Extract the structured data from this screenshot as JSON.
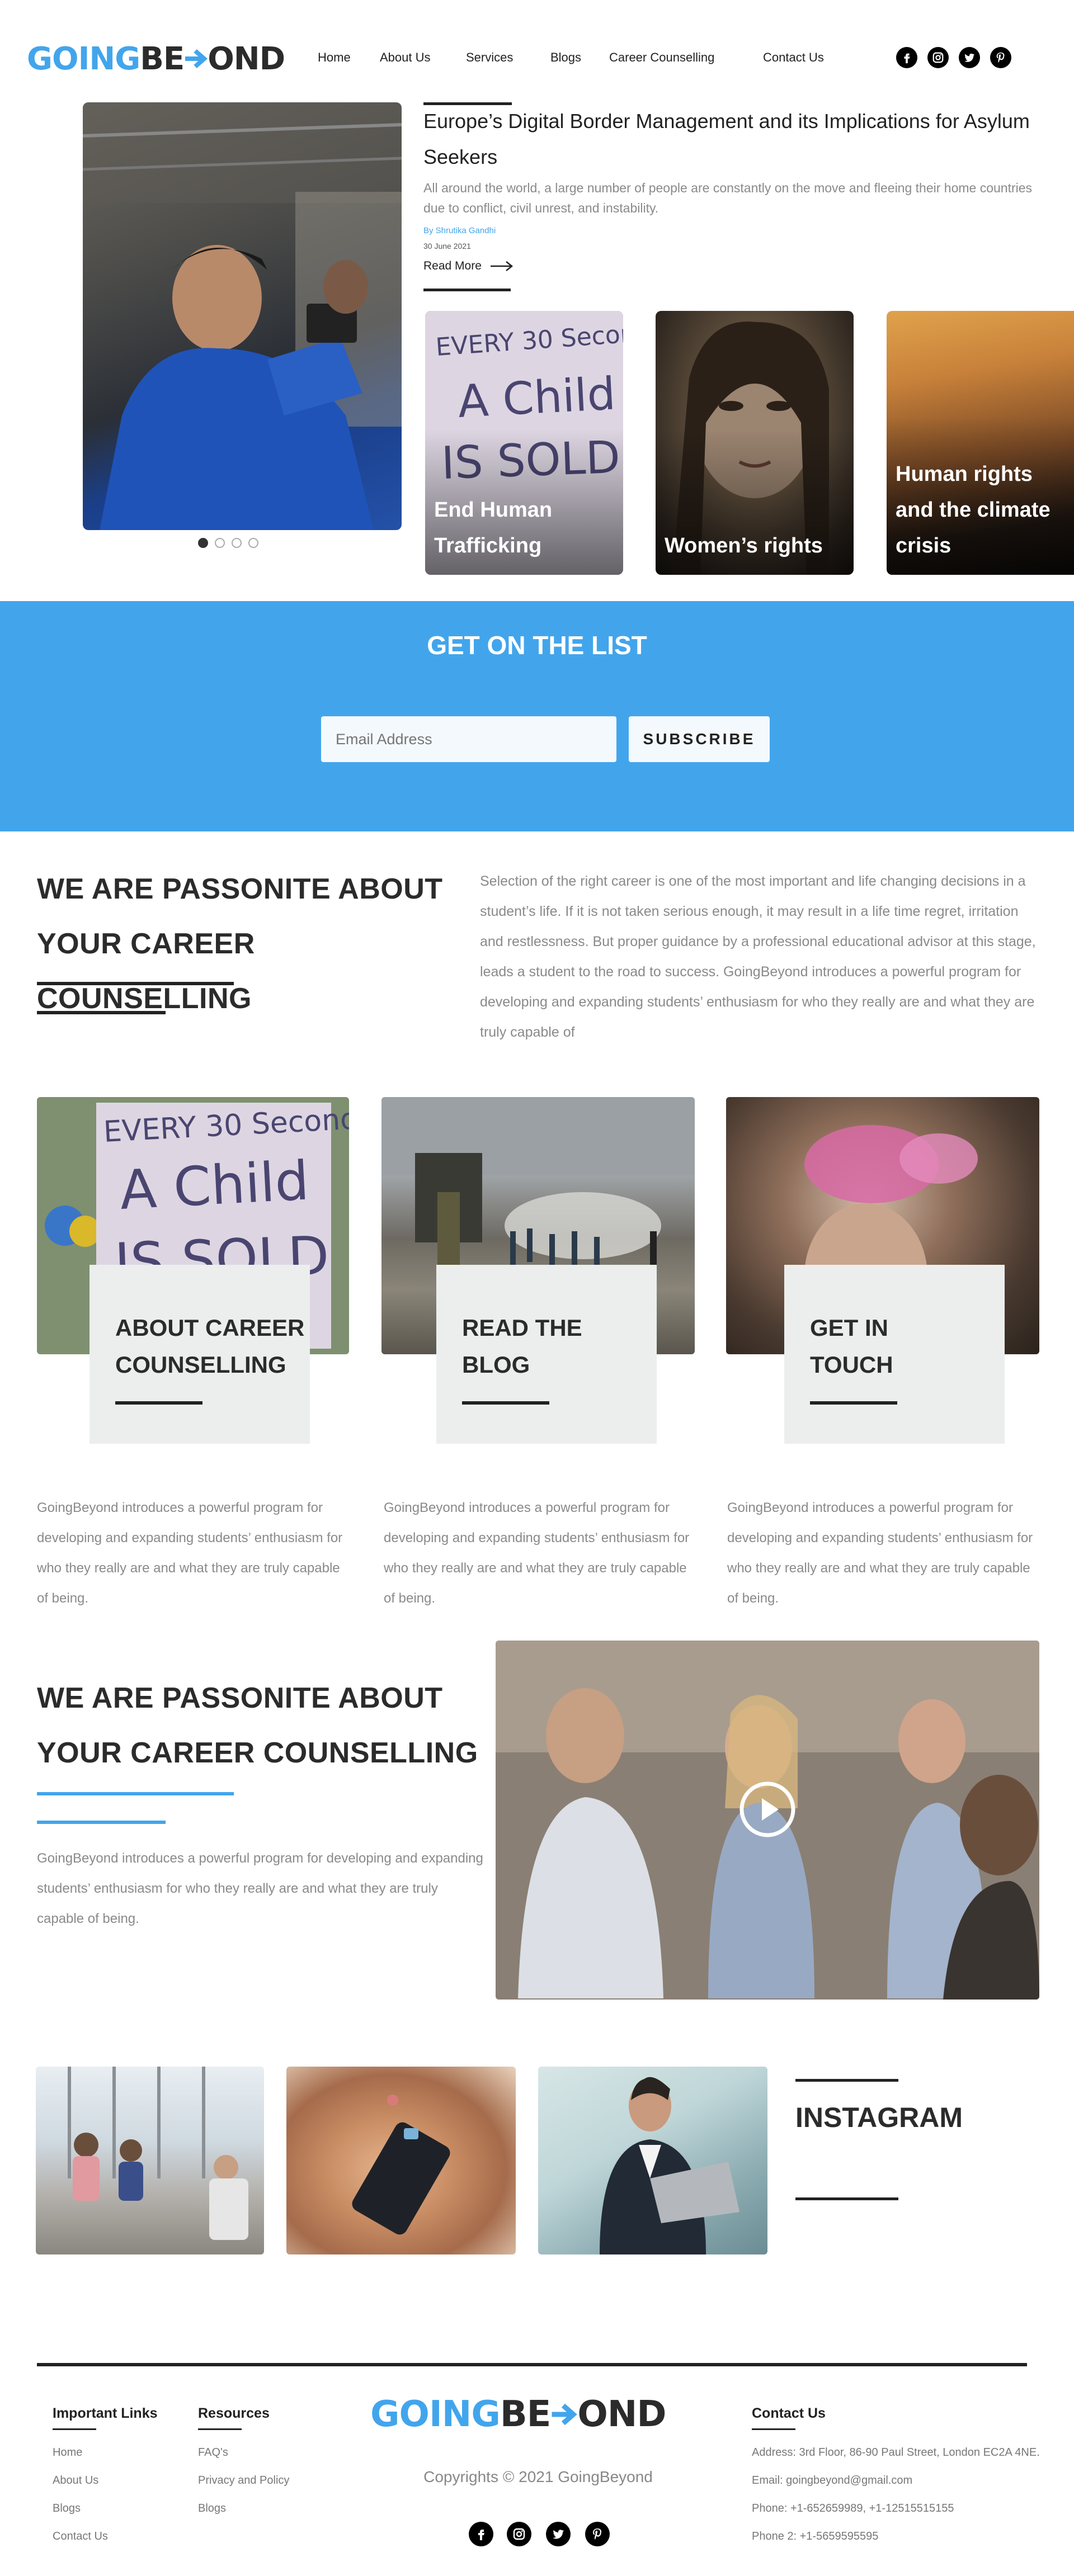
{
  "brand": {
    "going": "GOING",
    "be": "BE",
    "ond": "OND"
  },
  "nav": [
    "Home",
    "About Us",
    "Services",
    "Blogs",
    "Career Counselling",
    "Contact Us"
  ],
  "social_icons": [
    "facebook-icon",
    "instagram-icon",
    "twitter-icon",
    "pinterest-icon"
  ],
  "hero": {
    "title": "Europe’s Digital Border Management and its Implications for Asylum Seekers",
    "excerpt": "All around the world, a large number of people are constantly on the move and fleeing their home countries due to conflict, civil unrest, and instability.",
    "author": "By Shrutika Gandhi",
    "date": "30 June 2021",
    "read_more": "Read More",
    "slides": 4,
    "active_slide": 1,
    "cards": [
      "End Human Trafficking",
      "Women’s rights",
      "Human rights and the climate crisis"
    ]
  },
  "newsletter": {
    "heading": "GET ON THE LIST",
    "placeholder": "Email Address",
    "button": "SUBSCRIBE"
  },
  "about": {
    "heading": "WE ARE PASSONITE ABOUT YOUR CAREER COUNSELLING",
    "text": "Selection of the right career is one of the most important and life changing decisions in a student’s life. If it is not taken serious enough, it may result in a life time regret, irritation and restlessness. But proper guidance by a professional educational advisor at this stage, leads a student to the road to success. GoingBeyond introduces a powerful program for developing and expanding students’ enthusiasm for who they really are and what they are truly capable of"
  },
  "features": [
    {
      "title": "ABOUT CAREER COUNSELLING",
      "text": "GoingBeyond introduces a powerful program for developing and expanding students’ enthusiasm for who they really are and what they are truly capable of being."
    },
    {
      "title": "READ THE BLOG",
      "text": "GoingBeyond introduces a powerful program for developing and expanding students’ enthusiasm for who they really are and what they are truly capable of being."
    },
    {
      "title": "GET IN TOUCH",
      "text": "GoingBeyond introduces a powerful program for developing and expanding students’ enthusiasm for who they really are and what they are truly capable of being."
    }
  ],
  "video_section": {
    "heading": "WE ARE PASSONITE ABOUT YOUR CAREER COUNSELLING",
    "text": "GoingBeyond introduces a powerful program for developing and expanding students’ enthusiasm for who they really are and what they are truly capable of being."
  },
  "instagram": {
    "heading": "INSTAGRAM"
  },
  "footer": {
    "important_links": {
      "heading": "Important Links",
      "items": [
        "Home",
        "About Us",
        "Blogs",
        "Contact Us"
      ]
    },
    "resources": {
      "heading": "Resources",
      "items": [
        "FAQ's",
        "Privacy and Policy",
        "Blogs"
      ]
    },
    "copyright": "Copyrights © 2021 GoingBeyond",
    "contact": {
      "heading": "Contact Us",
      "address": "Address: 3rd Floor, 86-90 Paul Street, London EC2A 4NE.",
      "email": "Email: goingbeyond@gmail.com",
      "phone": "Phone: +1-652659989, +1-12515515155",
      "phone2": "Phone 2: +1-5659595595"
    }
  },
  "colors": {
    "accent": "#42a5ec",
    "dark": "#2b2b2b",
    "newsletter_bg": "#42a5ec"
  }
}
